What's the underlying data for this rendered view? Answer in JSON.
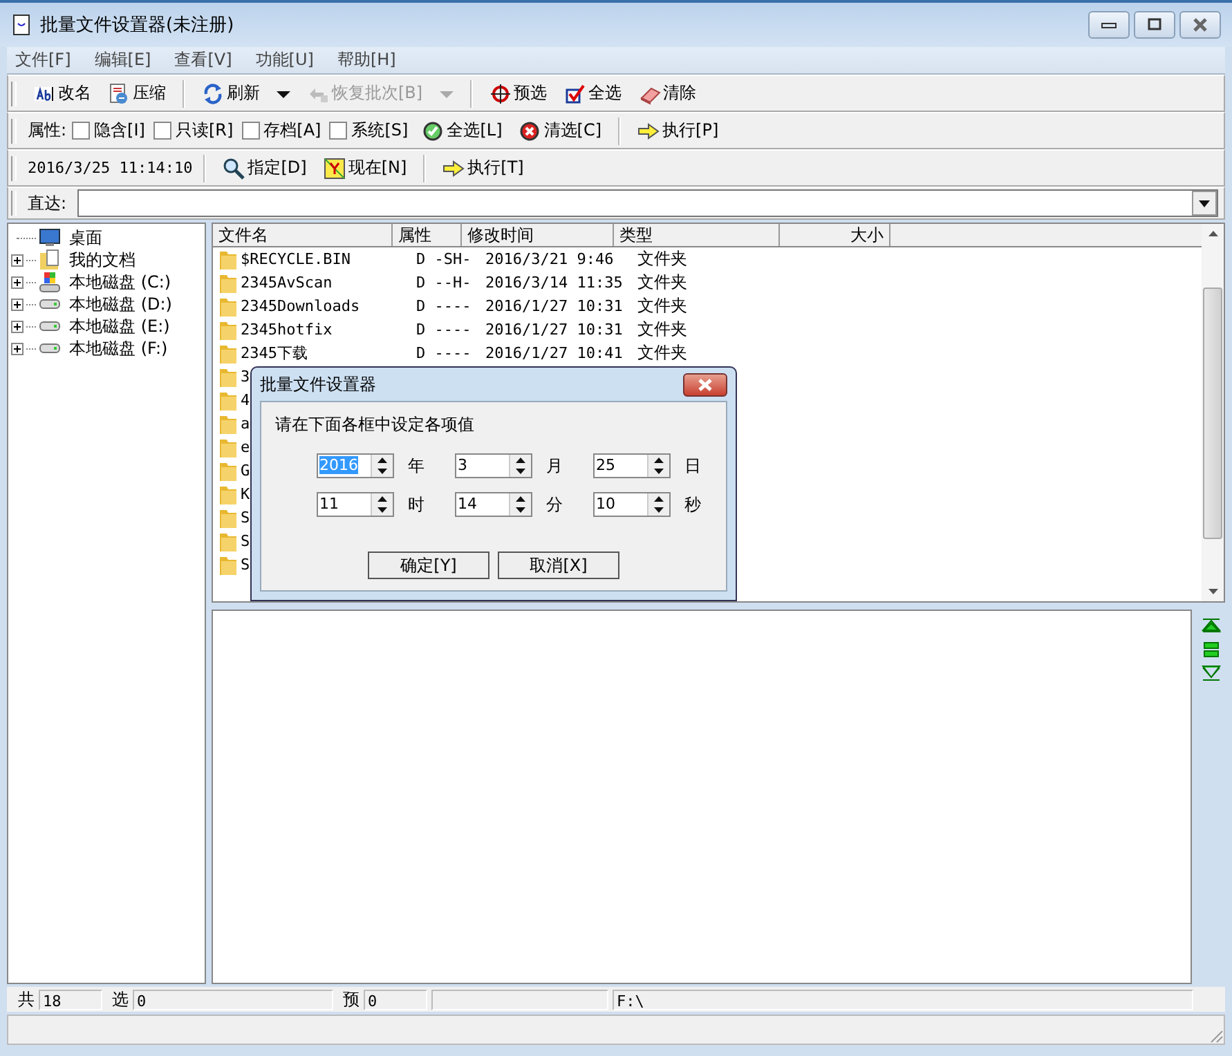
{
  "window": {
    "title": "批量文件设置器(未注册)"
  },
  "menu": [
    "文件[F]",
    "编辑[E]",
    "查看[V]",
    "功能[U]",
    "帮助[H]"
  ],
  "toolbar": [
    {
      "kind": "button",
      "label": "改名",
      "disabled": false
    },
    {
      "kind": "button",
      "label": "压缩",
      "disabled": false
    },
    {
      "kind": "separator"
    },
    {
      "kind": "button",
      "label": "刷新",
      "disabled": false
    },
    {
      "kind": "dropdown",
      "disabled": false
    },
    {
      "kind": "button",
      "label": "恢复批次[B]",
      "disabled": true
    },
    {
      "kind": "dropdown",
      "disabled": true
    },
    {
      "kind": "separator"
    },
    {
      "kind": "button",
      "label": "预选",
      "disabled": false
    },
    {
      "kind": "button",
      "label": "全选",
      "disabled": false
    },
    {
      "kind": "button",
      "label": "清除",
      "disabled": false
    }
  ],
  "attributes": {
    "label": "属性:",
    "checkboxes": [
      {
        "label": "隐含[I]",
        "checked": false
      },
      {
        "label": "只读[R]",
        "checked": false
      },
      {
        "label": "存档[A]",
        "checked": false
      },
      {
        "label": "系统[S]",
        "checked": false
      }
    ],
    "buttons": [
      "全选[L]",
      "清选[C]",
      "执行[P]"
    ]
  },
  "time_bar": {
    "value": "2016/3/25 11:14:10",
    "buttons": [
      "指定[D]",
      "现在[N]",
      "执行[T]"
    ]
  },
  "address": {
    "label": "直达:"
  },
  "tree": [
    {
      "kind": "desktop",
      "label": "桌面"
    },
    {
      "kind": "documents",
      "label": "我的文档",
      "expanded": false
    },
    {
      "kind": "system_drive",
      "label": "本地磁盘 (C:)",
      "expanded": false
    },
    {
      "kind": "drive",
      "label": "本地磁盘 (D:)",
      "expanded": false
    },
    {
      "kind": "drive",
      "label": "本地磁盘 (E:)",
      "expanded": false
    },
    {
      "kind": "drive",
      "label": "本地磁盘 (F:)",
      "expanded": false
    }
  ],
  "file_list": {
    "columns": [
      "文件名",
      "属性",
      "修改时间",
      "类型",
      "大小"
    ],
    "rows": [
      {
        "name": "$RECYCLE.BIN",
        "attributes": "D -SH-",
        "modified": "2016/3/21 9:46",
        "type": "文件夹"
      },
      {
        "name": "2345AvScan",
        "attributes": "D --H-",
        "modified": "2016/3/14 11:35",
        "type": "文件夹"
      },
      {
        "name": "2345Downloads",
        "attributes": "D ----",
        "modified": "2016/1/27 10:31",
        "type": "文件夹"
      },
      {
        "name": "2345hotfix",
        "attributes": "D ----",
        "modified": "2016/1/27 10:31",
        "type": "文件夹"
      },
      {
        "name": "2345下载",
        "attributes": "D ----",
        "modified": "2016/1/27 10:41",
        "type": "文件夹"
      },
      {
        "name": "3"
      },
      {
        "name": "4"
      },
      {
        "name": "a"
      },
      {
        "name": "e"
      },
      {
        "name": "G"
      },
      {
        "name": "K"
      },
      {
        "name": "S"
      },
      {
        "name": "S"
      },
      {
        "name": "S"
      }
    ]
  },
  "status_bar": [
    {
      "label": "共",
      "value": "18"
    },
    {
      "label": "选",
      "value": "0"
    },
    {
      "label": "预",
      "value": "0"
    },
    {
      "value": "F:\\"
    }
  ],
  "dialog": {
    "title": "批量文件设置器",
    "prompt": "请在下面各框中设定各项值",
    "fields": [
      {
        "value": "2016",
        "unit": "年",
        "selected": true
      },
      {
        "value": "3",
        "unit": "月",
        "selected": false
      },
      {
        "value": "25",
        "unit": "日",
        "selected": false
      },
      {
        "value": "11",
        "unit": "时",
        "selected": false
      },
      {
        "value": "14",
        "unit": "分",
        "selected": false
      },
      {
        "value": "10",
        "unit": "秒",
        "selected": false
      }
    ],
    "buttons": [
      "确定[Y]",
      "取消[X]"
    ]
  }
}
